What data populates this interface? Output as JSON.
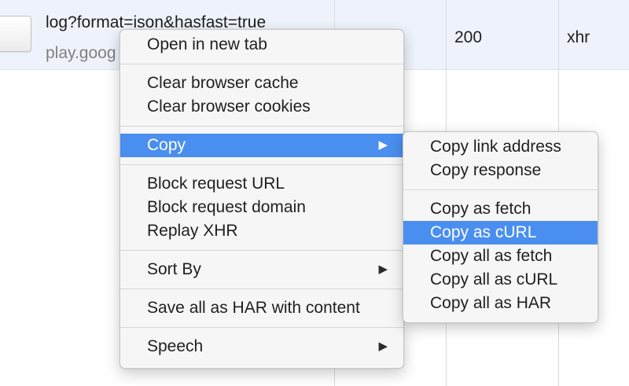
{
  "request": {
    "name": "log?format=ison&hasfast=true",
    "domain": "play.goog",
    "status": "200",
    "type": "xhr"
  },
  "context_menu": {
    "open_new_tab": "Open in new tab",
    "clear_cache": "Clear browser cache",
    "clear_cookies": "Clear browser cookies",
    "copy": "Copy",
    "block_url": "Block request URL",
    "block_domain": "Block request domain",
    "replay_xhr": "Replay XHR",
    "sort_by": "Sort By",
    "save_har": "Save all as HAR with content",
    "speech": "Speech",
    "submenu_arrow": "▶"
  },
  "copy_submenu": {
    "copy_link": "Copy link address",
    "copy_response": "Copy response",
    "copy_fetch": "Copy as fetch",
    "copy_curl": "Copy as cURL",
    "copy_all_fetch": "Copy all as fetch",
    "copy_all_curl": "Copy all as cURL",
    "copy_all_har": "Copy all as HAR"
  },
  "colors": {
    "highlight": "#4a8ff0",
    "row_selected": "#eef3fb"
  }
}
